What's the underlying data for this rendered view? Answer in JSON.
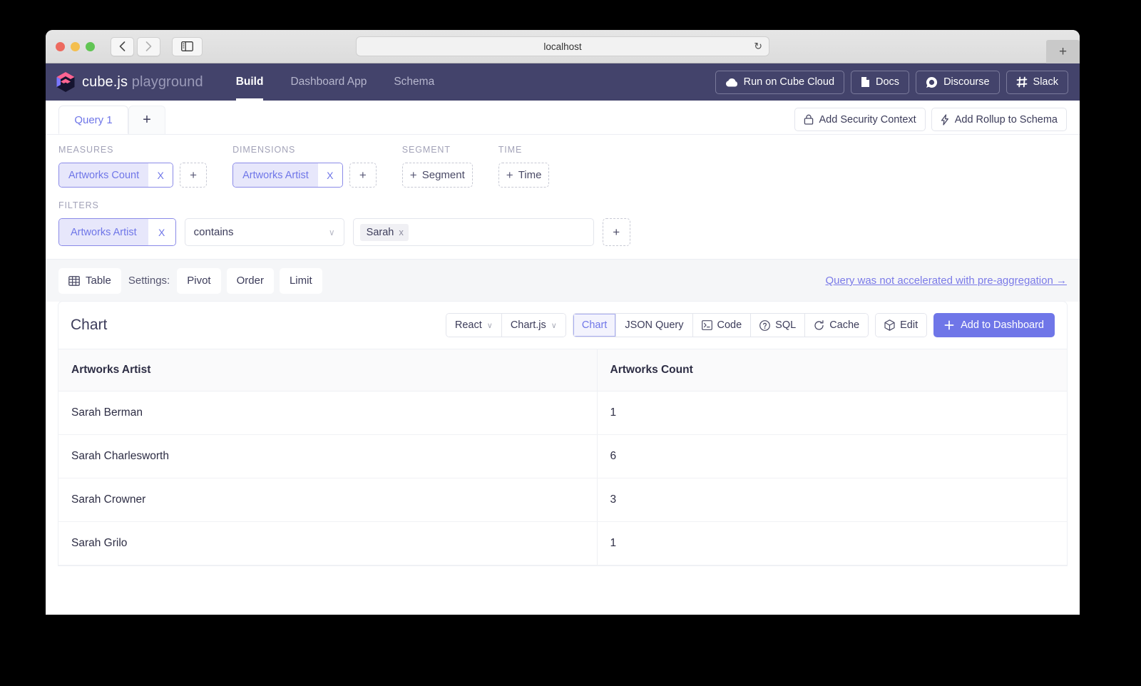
{
  "browser": {
    "url": "localhost",
    "back_icon": "chevron-left-icon",
    "forward_icon": "chevron-right-icon",
    "sidebar_icon": "sidebar-toggle-icon",
    "reload_icon": "reload-icon",
    "new_tab_label": "+"
  },
  "app_header": {
    "brand_name": "cube.js",
    "brand_suffix": "playground",
    "nav": [
      {
        "label": "Build",
        "active": true
      },
      {
        "label": "Dashboard App",
        "active": false
      },
      {
        "label": "Schema",
        "active": false
      }
    ],
    "actions": [
      {
        "label": "Run on Cube Cloud",
        "icon": "cloud-icon"
      },
      {
        "label": "Docs",
        "icon": "document-icon"
      },
      {
        "label": "Discourse",
        "icon": "discourse-icon"
      },
      {
        "label": "Slack",
        "icon": "slack-icon"
      }
    ]
  },
  "query_tabs": {
    "tabs": [
      {
        "label": "Query 1",
        "active": true
      }
    ],
    "add_label": "+",
    "security_context_label": "Add Security Context",
    "security_context_icon": "lock-icon",
    "rollup_label": "Add Rollup to Schema",
    "rollup_icon": "bolt-icon"
  },
  "builder": {
    "measures": {
      "label": "MEASURES",
      "chips": [
        {
          "name": "Artworks Count",
          "remove": "X"
        }
      ],
      "add": "+"
    },
    "dimensions": {
      "label": "DIMENSIONS",
      "chips": [
        {
          "name": "Artworks Artist",
          "remove": "X"
        }
      ],
      "add": "+"
    },
    "segment": {
      "label": "SEGMENT",
      "add_label": "Segment",
      "add_icon": "plus-icon"
    },
    "time": {
      "label": "TIME",
      "add_label": "Time",
      "add_icon": "plus-icon"
    },
    "filters": {
      "label": "FILTERS",
      "chip": {
        "name": "Artworks Artist",
        "remove": "X"
      },
      "operator": "contains",
      "operator_caret": "chevron-down-icon",
      "values": [
        {
          "text": "Sarah",
          "remove": "x"
        }
      ],
      "add": "+"
    }
  },
  "settings": {
    "view_label": "Table",
    "view_icon": "table-icon",
    "settings_label": "Settings:",
    "options": [
      "Pivot",
      "Order",
      "Limit"
    ],
    "accel_link": "Query was not accelerated with pre-aggregation →"
  },
  "panel": {
    "title": "Chart",
    "framework": {
      "label": "React",
      "caret": "chevron-down-icon"
    },
    "library": {
      "label": "Chart.js",
      "caret": "chevron-down-icon"
    },
    "views": [
      {
        "label": "Chart",
        "active": true,
        "icon": null
      },
      {
        "label": "JSON Query",
        "active": false,
        "icon": null
      },
      {
        "label": "Code",
        "active": false,
        "icon": "terminal-icon"
      },
      {
        "label": "SQL",
        "active": false,
        "icon": "question-icon"
      },
      {
        "label": "Cache",
        "active": false,
        "icon": "refresh-icon"
      }
    ],
    "edit": {
      "label": "Edit",
      "icon": "cube-icon"
    },
    "add_to_dashboard": {
      "label": "Add to Dashboard",
      "icon": "plus-icon"
    }
  },
  "table": {
    "columns": [
      "Artworks Artist",
      "Artworks Count"
    ],
    "rows": [
      {
        "artist": "Sarah Berman",
        "count": "1"
      },
      {
        "artist": "Sarah Charlesworth",
        "count": "6"
      },
      {
        "artist": "Sarah Crowner",
        "count": "3"
      },
      {
        "artist": "Sarah Grilo",
        "count": "1"
      }
    ]
  },
  "colors": {
    "accent": "#6f76e8",
    "header_bg": "#43436b",
    "chip_bg": "#e7e7fb",
    "page_bg": "#f5f6f8"
  }
}
